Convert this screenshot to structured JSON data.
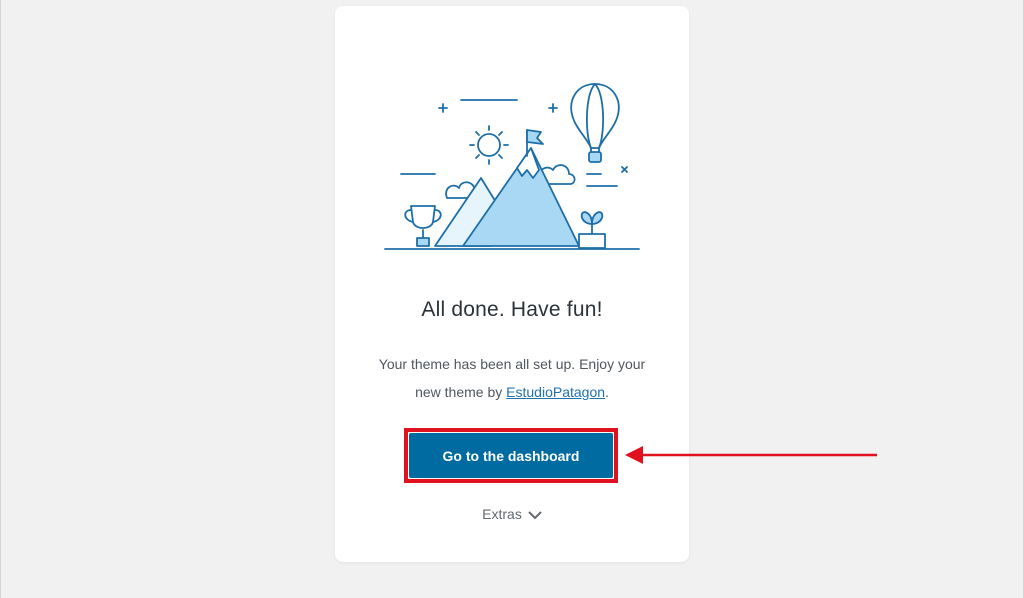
{
  "card": {
    "title": "All done. Have fun!",
    "desc_before": "Your theme has been all set up. Enjoy your new theme by ",
    "desc_link": "EstudioPatagon",
    "desc_after": "."
  },
  "primary_button": {
    "label": "Go to the dashboard"
  },
  "extras": {
    "label": "Extras"
  },
  "colors": {
    "button_bg": "#006ba1",
    "highlight": "#e0121f",
    "illustration_stroke": "#1e6fa8",
    "illustration_fill": "#a8d8f4"
  }
}
